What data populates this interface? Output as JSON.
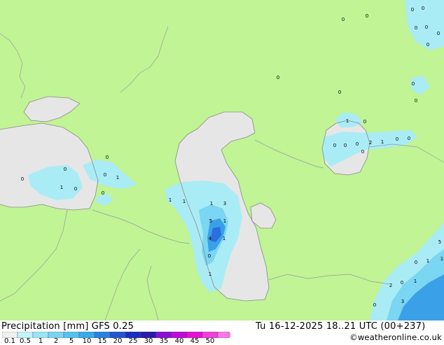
{
  "footer": {
    "title": "Precipitation [mm]  GFS 0.25",
    "run": "Tu 16-12-2025 18..21 UTC (00+237)",
    "credit": "©weatheronline.co.uk"
  },
  "legend": {
    "labels": [
      "0.1",
      "0.5",
      "1",
      "2",
      "5",
      "10",
      "15",
      "20",
      "25",
      "30",
      "35",
      "40",
      "45",
      "50"
    ],
    "colors": [
      "#f0f0f0",
      "#c0f4f8",
      "#9ae4f4",
      "#78d4f2",
      "#55c2ee",
      "#3aa8ea",
      "#2a82e0",
      "#2356cf",
      "#1a2ec0",
      "#2a1aa8",
      "#8a10d8",
      "#c00ad8",
      "#e410d8",
      "#f040d8",
      "#f878e8"
    ]
  },
  "map": {
    "colors": {
      "land": "#c0f494",
      "water": "#e6e6e6",
      "border": "#9a9a9a",
      "coast": "#8a8a8a",
      "light_precip": "#a9ecf6",
      "mid_precip": "#7ad6f2",
      "heavy_precip": "#3aa0e8",
      "heaviest_precip": "#2a6ee0"
    },
    "precip_values": [
      "0",
      "0",
      "0",
      "0",
      "0",
      "0",
      "0",
      "0",
      "0",
      "0",
      "0",
      "0",
      "1",
      "0",
      "0",
      "0",
      "0",
      "0",
      "2",
      "1",
      "0",
      "0",
      "0",
      "0",
      "1",
      "0",
      "0",
      "1",
      "0",
      "0",
      "1",
      "1",
      "1",
      "3",
      "5",
      "1",
      "4",
      "1",
      "0",
      "1",
      "5",
      "1",
      "0",
      "1",
      "2",
      "0",
      "1",
      "3",
      "0"
    ]
  }
}
